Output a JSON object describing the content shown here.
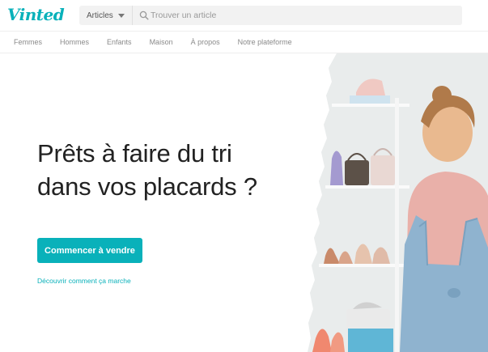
{
  "brand": {
    "logo_text": "Vinted",
    "accent_color": "#09b1ba"
  },
  "search": {
    "category_label": "Articles",
    "placeholder": "Trouver un article",
    "icon": "search-icon"
  },
  "nav": {
    "items": [
      "Femmes",
      "Hommes",
      "Enfants",
      "Maison",
      "À propos",
      "Notre plateforme"
    ]
  },
  "hero": {
    "headline_line1": "Prêts à faire du tri",
    "headline_line2": "dans vos placards ?",
    "cta_label": "Commencer à vendre",
    "link_label": "Découvrir comment ça marche"
  }
}
